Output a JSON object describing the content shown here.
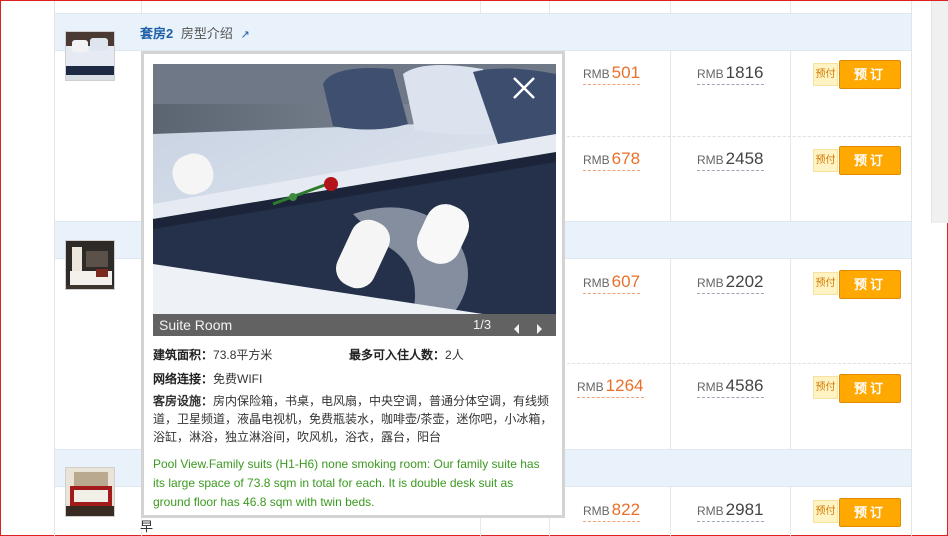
{
  "room_header": {
    "name": "套房2",
    "intro": "房型介绍",
    "arrow": "↗"
  },
  "stray_text": "早",
  "offers": [
    {
      "currency": "RMB",
      "price": "501",
      "total_currency": "RMB",
      "total": "1816",
      "prepay_label": "预付",
      "book_label": "预订"
    },
    {
      "currency": "RMB",
      "price": "678",
      "total_currency": "RMB",
      "total": "2458",
      "prepay_label": "预付",
      "book_label": "预订"
    },
    {
      "currency": "RMB",
      "price": "607",
      "total_currency": "RMB",
      "total": "2202",
      "prepay_label": "预付",
      "book_label": "预订"
    },
    {
      "currency": "RMB",
      "price": "1264",
      "total_currency": "RMB",
      "total": "4586",
      "prepay_label": "预付",
      "book_label": "预订"
    },
    {
      "currency": "RMB",
      "price": "822",
      "total_currency": "RMB",
      "total": "2981",
      "prepay_label": "预付",
      "book_label": "预订"
    }
  ],
  "popup": {
    "caption": "Suite Room",
    "counter": "1/3",
    "area_label": "建筑面积：",
    "area_value": "73.8平方米",
    "occupancy_label": "最多可入住人数：",
    "occupancy_value": "2人",
    "network_label": "网络连接：",
    "network_value": "免费WIFI",
    "facilities_label": "客房设施：",
    "facilities_value": "房内保险箱，书桌，电风扇，中央空调，普通分体空调，有线频道，卫星频道，液晶电视机，免费瓶装水，咖啡壶/茶壶，迷你吧，小冰箱，浴缸，淋浴，独立淋浴间，吹风机，浴衣，露台，阳台",
    "description": "Pool View.Family suits (H1-H6) none smoking room: Our family suite has its large space of 73.8 sqm in total for each. It is double desk suit as ground floor has 46.8 sqm with twin beds."
  },
  "colors": {
    "accent_orange": "#ffa800",
    "price_orange": "#e8702a",
    "link_blue": "#1e5fa8",
    "description_green": "#3a9a1f"
  },
  "icons": [
    "close-icon",
    "prev-arrow-icon",
    "next-arrow-icon",
    "external-link-icon"
  ]
}
